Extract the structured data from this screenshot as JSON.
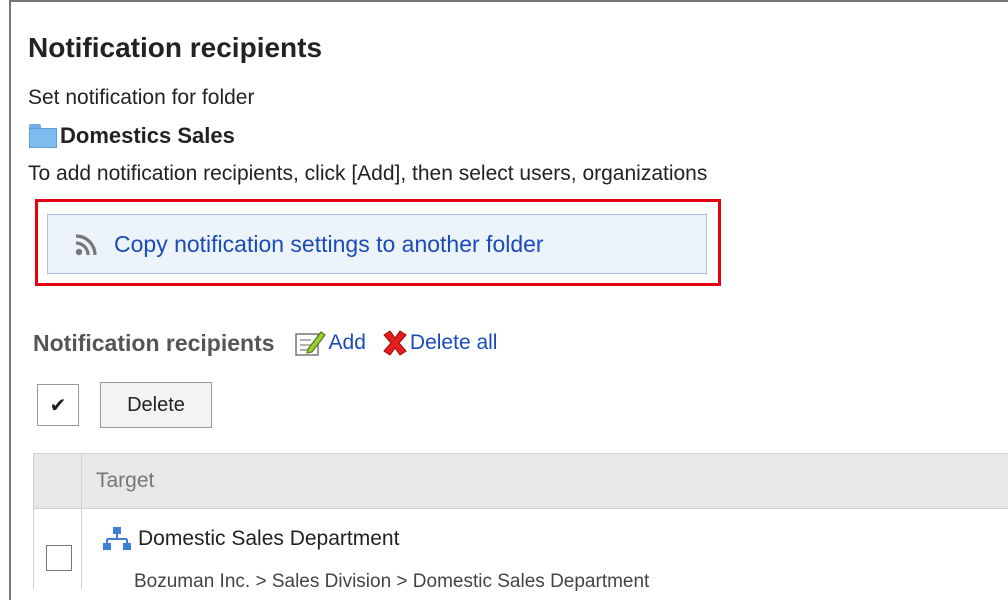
{
  "header": {
    "title": "Notification recipients",
    "subtitle": "Set notification for folder",
    "folder_name": "Domestics Sales",
    "instructions": "To add notification recipients, click [Add], then select users, organizations"
  },
  "copy_button": {
    "label": "Copy notification settings to another folder",
    "icon": "rss-icon"
  },
  "recipients": {
    "section_title": "Notification recipients",
    "add_label": "Add",
    "delete_all_label": "Delete all",
    "check_all_glyph": "✔",
    "delete_button_label": "Delete",
    "column_target": "Target",
    "rows": [
      {
        "name": "Domestic Sales Department",
        "path": "Bozuman Inc. > Sales Division > Domestic Sales Department",
        "icon": "organization-icon"
      }
    ]
  },
  "colors": {
    "link": "#1a4bb8",
    "highlight": "#e60012",
    "folder": "#7fbdf0"
  }
}
